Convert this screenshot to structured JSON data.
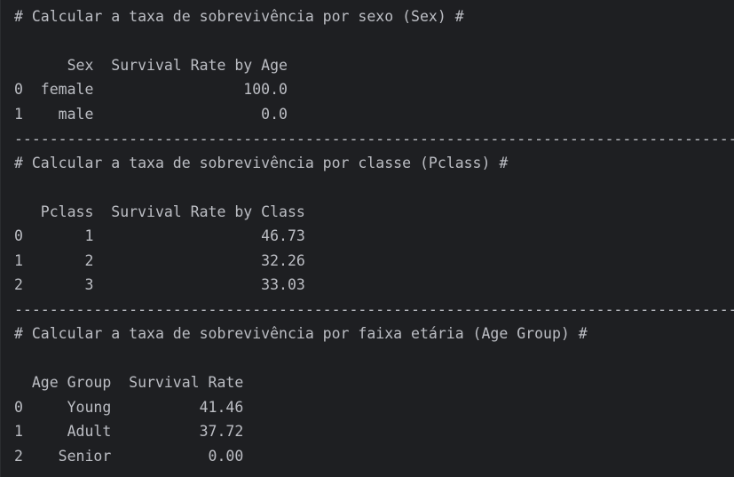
{
  "console": {
    "lines": [
      "# Calcular a taxa de sobrevivência por sexo (Sex) #",
      "",
      "      Sex  Survival Rate by Age",
      "0  female                 100.0",
      "1    male                   0.0",
      "--------------------------------------------------------------------------------------------",
      "# Calcular a taxa de sobrevivência por classe (Pclass) #",
      "",
      "   Pclass  Survival Rate by Class",
      "0       1                   46.73",
      "1       2                   32.26",
      "2       3                   33.03",
      "--------------------------------------------------------------------------------------------",
      "# Calcular a taxa de sobrevivência por faixa etária (Age Group) #",
      "",
      "  Age Group  Survival Rate",
      "0     Young          41.46",
      "1     Adult          37.72",
      "2    Senior           0.00"
    ]
  },
  "colors": {
    "background": "#1e1f22",
    "text": "#bcbec4"
  }
}
